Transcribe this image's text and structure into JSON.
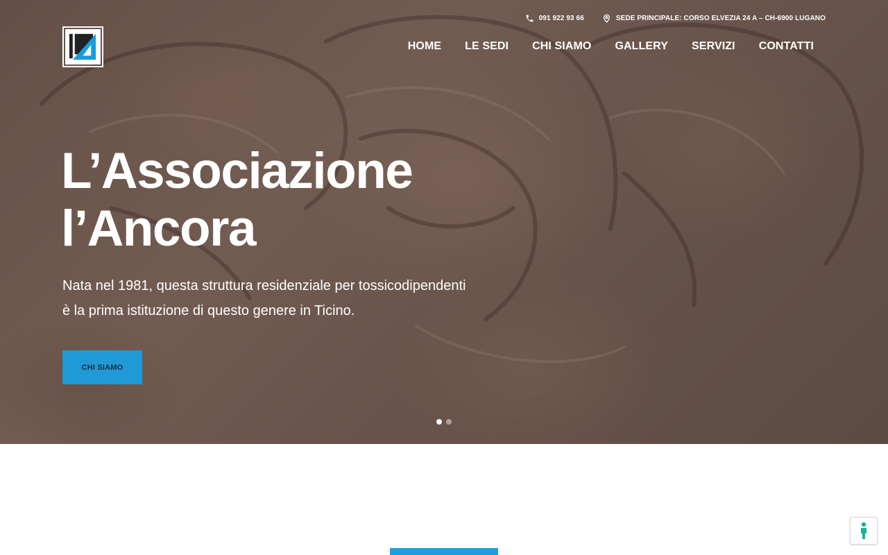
{
  "topbar": {
    "phone": "091 922 93 66",
    "phone_icon": "phone-icon",
    "address": "SEDE PRINCIPALE: CORSO ELVEZIA 24 A – CH-6900 LUGANO",
    "address_icon": "location-pin-icon"
  },
  "logo": {
    "letters": "LZA",
    "dark": "#222222",
    "accent": "#1a9be0"
  },
  "nav": {
    "home": "HOME",
    "sedi": "LE SEDI",
    "chi_siamo": "CHI SIAMO",
    "gallery": "GALLERY",
    "servizi": "SERVIZI",
    "contatti": "CONTATTI"
  },
  "hero": {
    "title_line1": "L’Associazione",
    "title_line2": "l’Ancora",
    "subtitle_line1": "Nata nel 1981, questa struttura residenziale per tossicodipendenti",
    "subtitle_line2": "è la prima istituzione di questo genere in Ticino.",
    "cta_label": "CHI SIAMO",
    "slides_total": 2,
    "slide_active": 1
  },
  "colors": {
    "accent": "#1f9ad6",
    "bar": "#1aa0df",
    "a11y_icon": "#19b394"
  },
  "accessibility_icon": "accessibility-person-icon"
}
